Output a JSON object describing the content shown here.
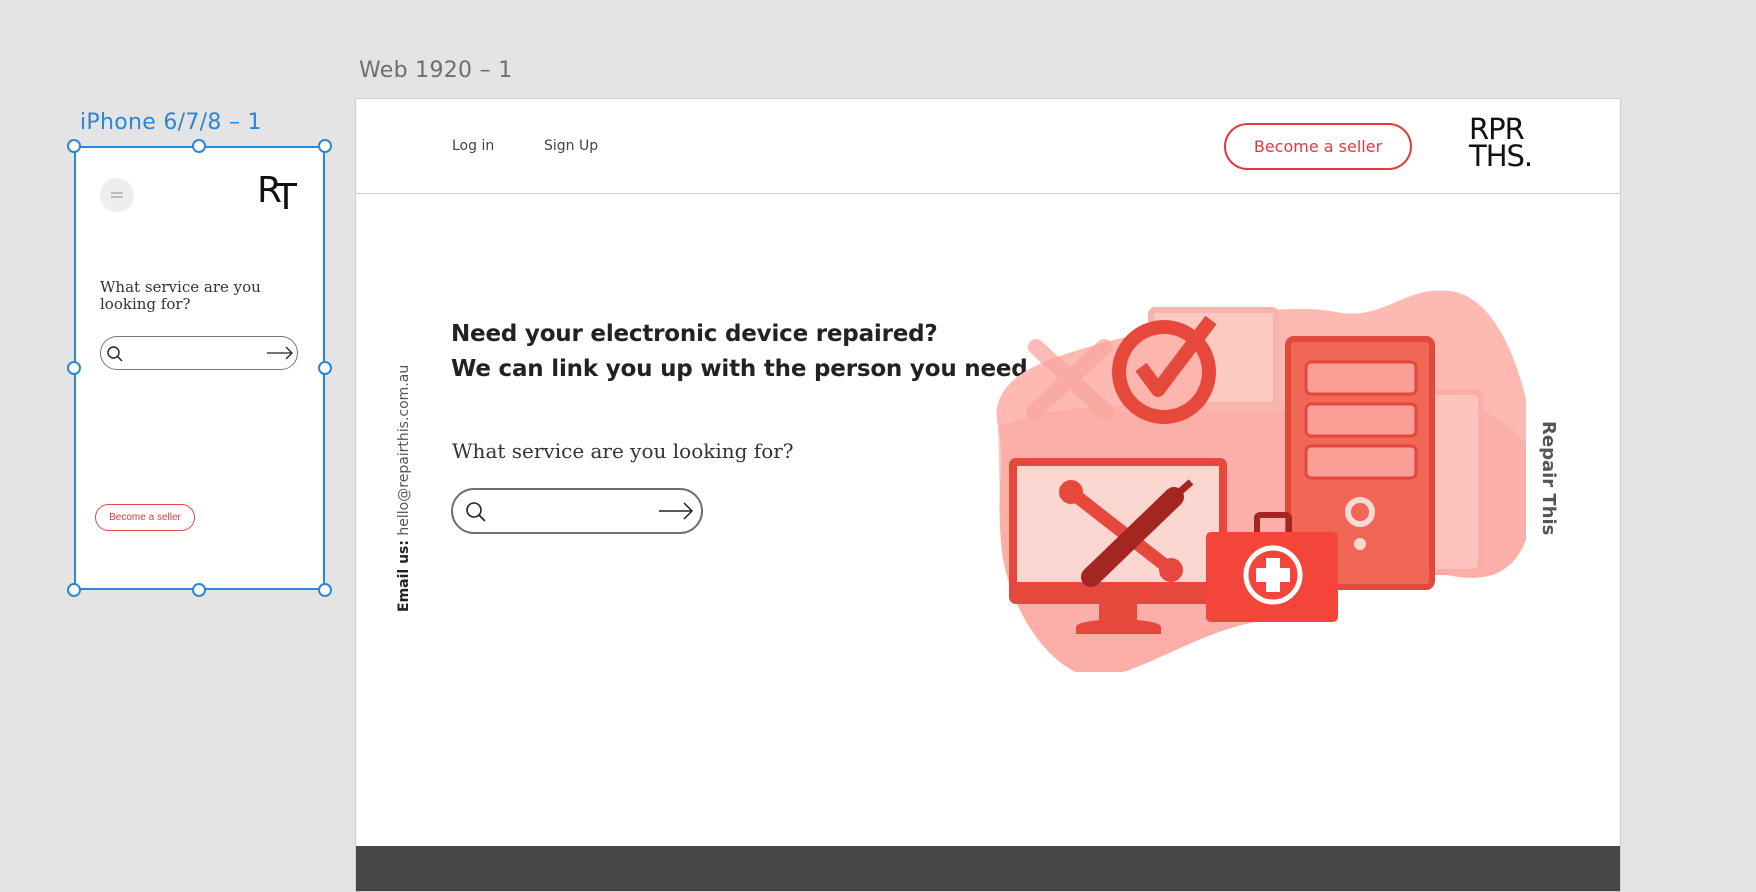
{
  "canvas": {
    "web_artboard_label": "Web 1920 – 1",
    "phone_artboard_label": "iPhone 6/7/8 – 1"
  },
  "mobile": {
    "logo": "RT",
    "menu_icon": "hamburger-icon",
    "question": "What service are you looking for?",
    "search_icon": "search-icon",
    "submit_icon": "arrow-right-icon",
    "seller_button": "Become a seller"
  },
  "web": {
    "nav": {
      "login": "Log in",
      "signup": "Sign Up"
    },
    "seller_button": "Become a seller",
    "logo_line1": "RPR",
    "logo_line2": "THS.",
    "email_label": "Email us:",
    "email_value": "hello@repairthis.com.au",
    "side_brand": "Repair This",
    "headline_line1": "Need your electronic device repaired?",
    "headline_line2": "We can link you up with the person you need.",
    "question": "What service are you looking for?",
    "search_icon": "search-icon",
    "submit_icon": "arrow-right-icon",
    "illustration": "electronics-repair-illustration"
  },
  "colors": {
    "accent_red": "#e23a3a",
    "selection_blue": "#2a87d8",
    "footer_dark": "#474747",
    "illustration_pink": "#fdb9b2",
    "illustration_red": "#f2574a"
  }
}
